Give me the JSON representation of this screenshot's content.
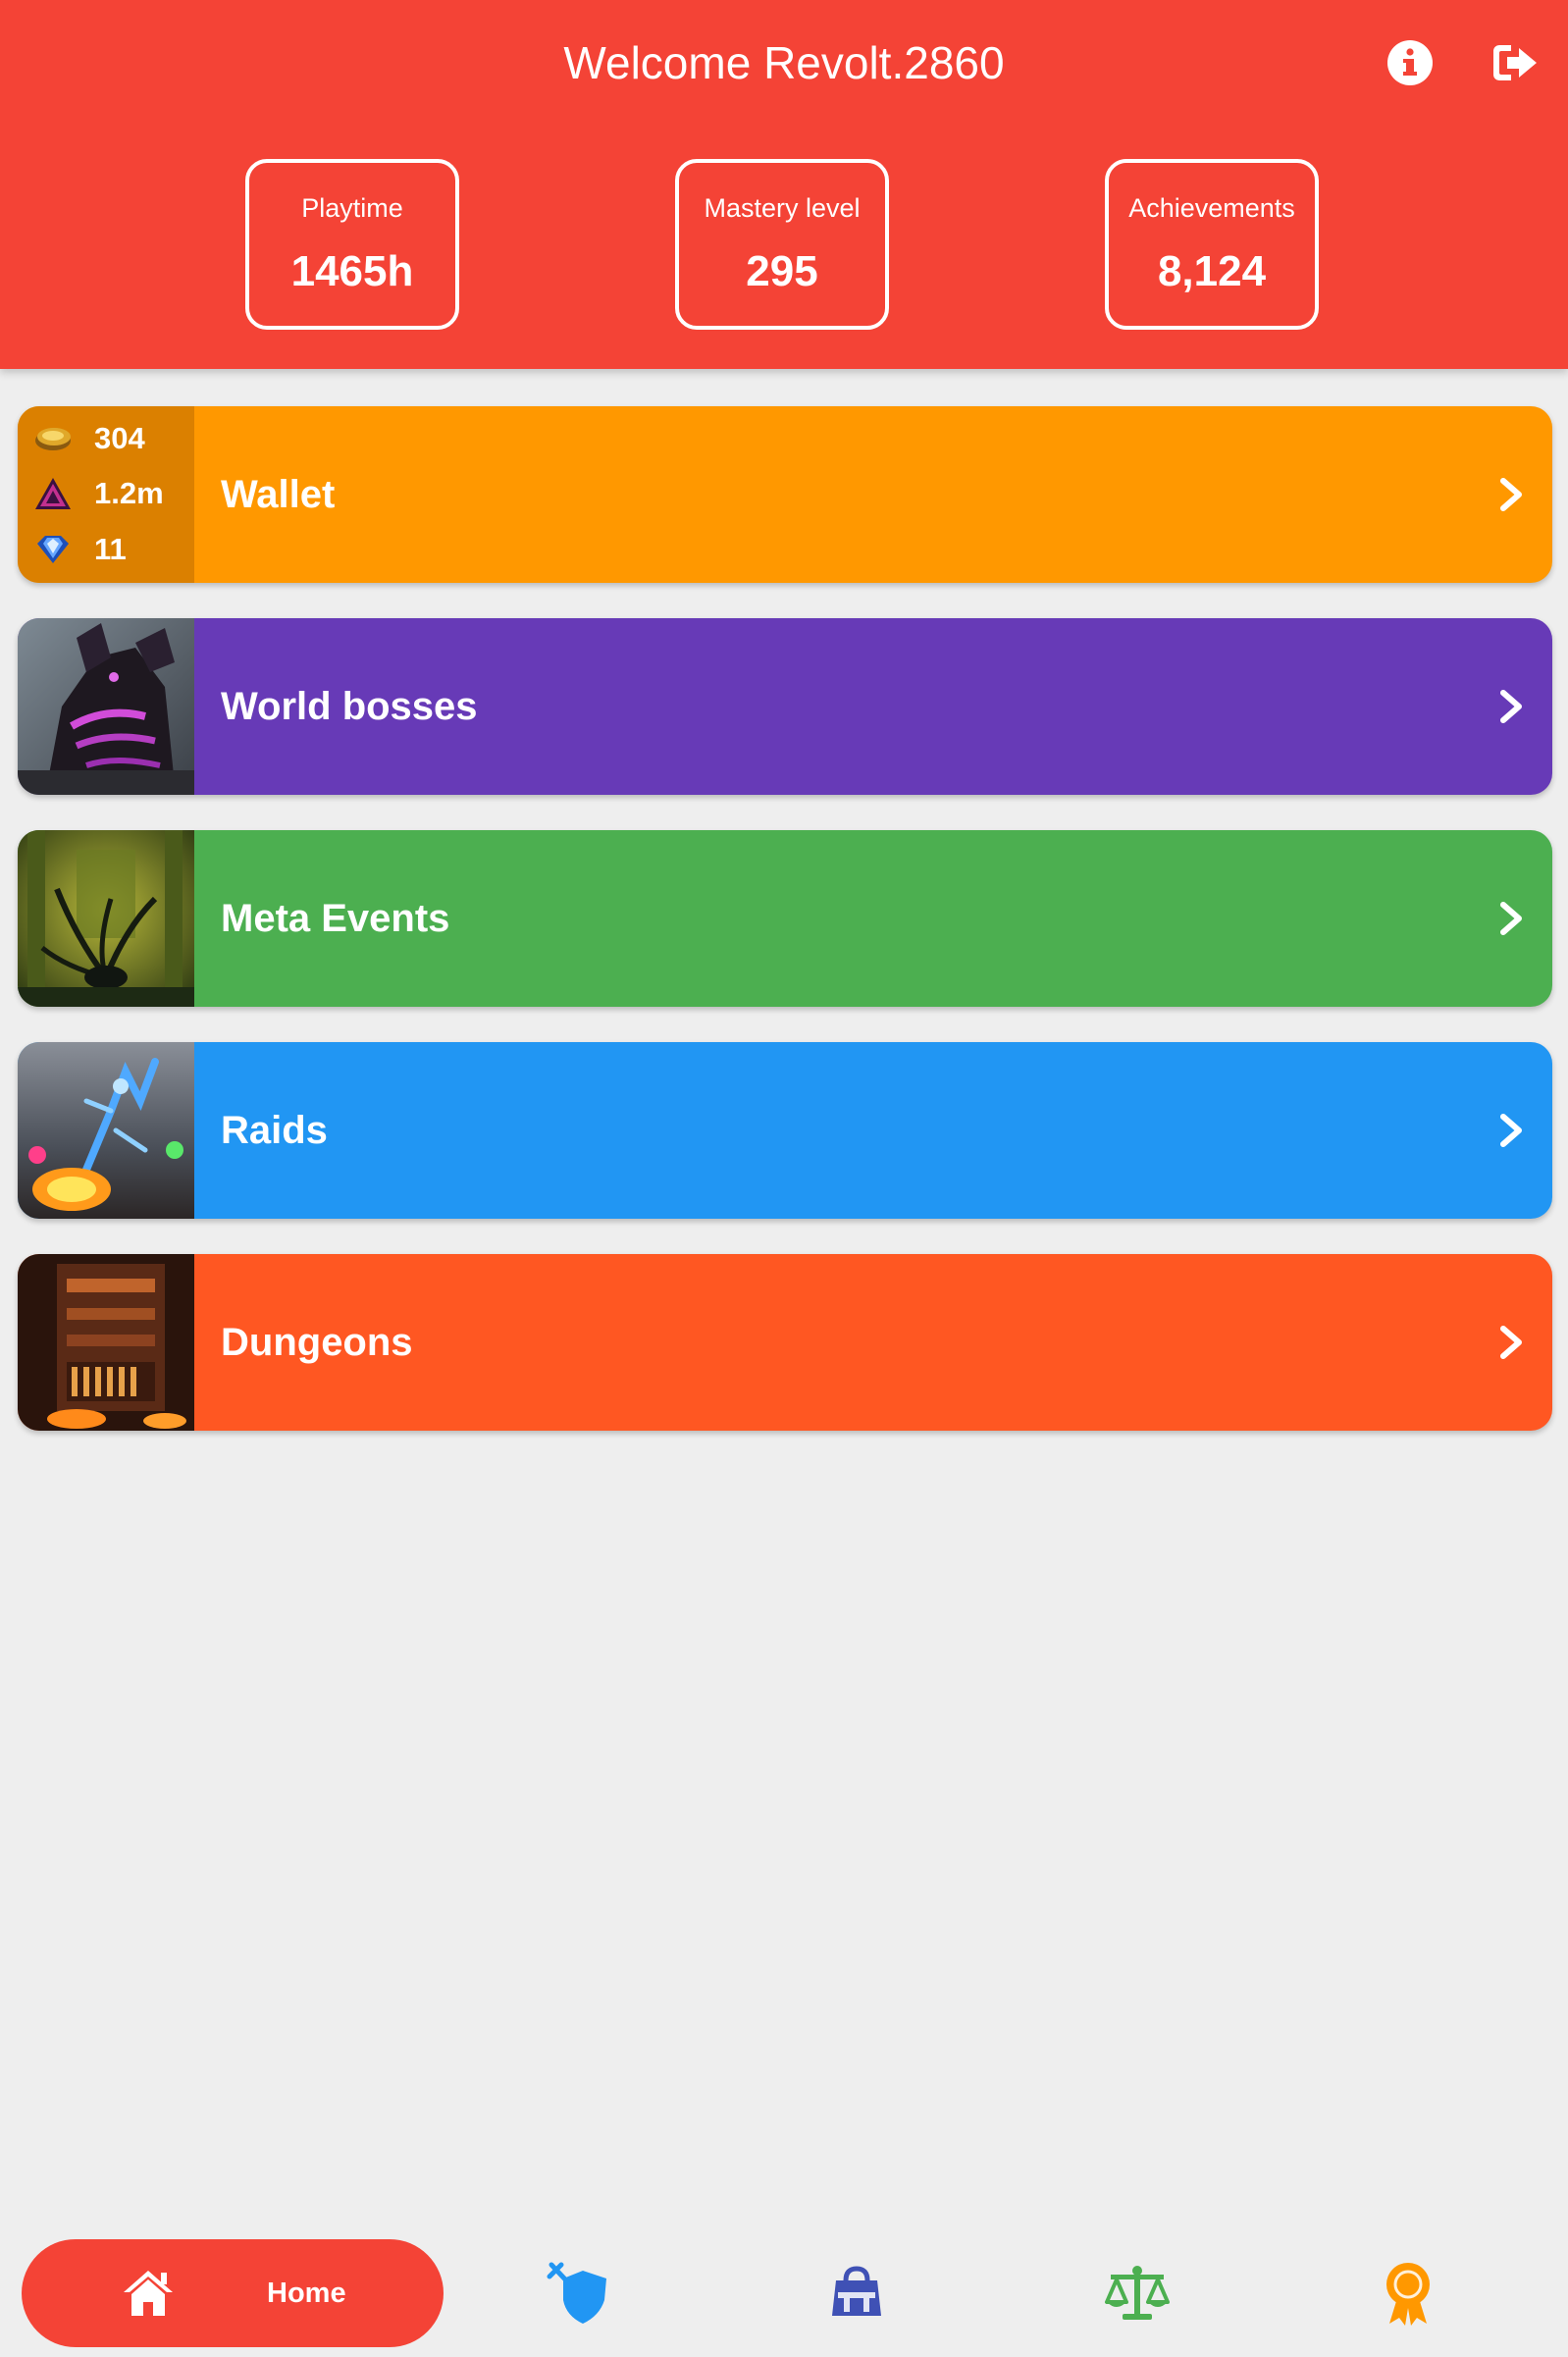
{
  "header": {
    "welcome_prefix": "Welcome",
    "username": "Revolt.2860",
    "info_icon": "info-circle-icon",
    "logout_icon": "sign-out-icon",
    "background_color": "#f44336"
  },
  "stats": [
    {
      "label": "Playtime",
      "value": "1465h"
    },
    {
      "label": "Mastery level",
      "value": "295"
    },
    {
      "label": "Achievements",
      "value": "8,124"
    }
  ],
  "wallet": {
    "label": "Wallet",
    "color": "#ff9800",
    "currencies": [
      {
        "icon": "gold-coin-icon",
        "amount": "304"
      },
      {
        "icon": "karma-icon",
        "amount": "1.2m"
      },
      {
        "icon": "gem-icon",
        "amount": "11"
      }
    ]
  },
  "cards": [
    {
      "label": "World bosses",
      "color": "#673ab7",
      "icon": "dragon-thumbnail"
    },
    {
      "label": "Meta Events",
      "color": "#4caf50",
      "icon": "tentacle-thumbnail"
    },
    {
      "label": "Raids",
      "color": "#2196f3",
      "icon": "raid-thumbnail"
    },
    {
      "label": "Dungeons",
      "color": "#ff5722",
      "icon": "dungeon-thumbnail"
    }
  ],
  "bottom_nav": {
    "home_label": "Home",
    "items": [
      {
        "icon": "home-icon",
        "color": "#f44336"
      },
      {
        "icon": "pvp-shield-icon",
        "color": "#2196f3"
      },
      {
        "icon": "store-icon",
        "color": "#3f51b5"
      },
      {
        "icon": "trading-scale-icon",
        "color": "#4caf50"
      },
      {
        "icon": "achievement-ribbon-icon",
        "color": "#ff9800"
      }
    ]
  }
}
